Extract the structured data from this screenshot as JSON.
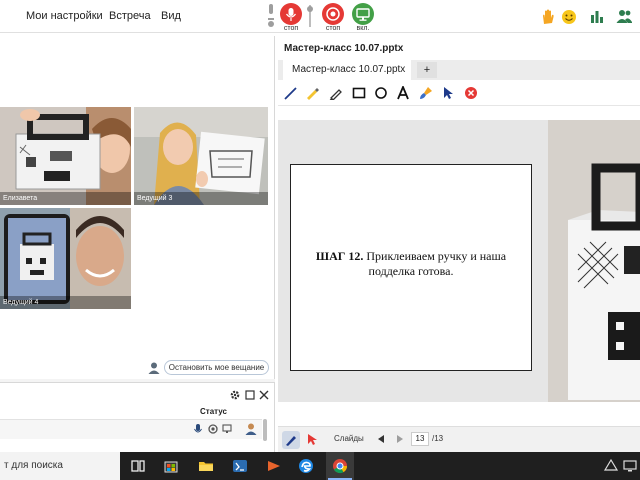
{
  "menu": {
    "settings": "Мои настройки",
    "meeting": "Встреча",
    "view": "Вид"
  },
  "controls": {
    "mic_label": "стоп",
    "camera_label": "стоп",
    "screen_label": "вкл."
  },
  "videos": {
    "tile1_name": "Елизавета",
    "tile2_name": "Ведущий 3",
    "tile3_name": "Ведущий 4",
    "stop_broadcast": "Остановить мое вещание"
  },
  "participants": {
    "status_header": "Статус"
  },
  "presentation": {
    "title": "Мастер-класс 10.07.pptx",
    "tab_label": "Мастер-класс 10.07.pptx",
    "add_tab": "+",
    "slide_bold": "ШАГ 12.",
    "slide_rest": " Приклеиваем ручку и наша подделка готова.",
    "slides_label": "Слайды",
    "current_slide": "13",
    "total_slides": "/13"
  },
  "taskbar": {
    "search": "т для поиска"
  },
  "colors": {
    "record_red": "#e53935",
    "screen_green": "#43a047",
    "accent_blue": "#1e3a8a"
  }
}
